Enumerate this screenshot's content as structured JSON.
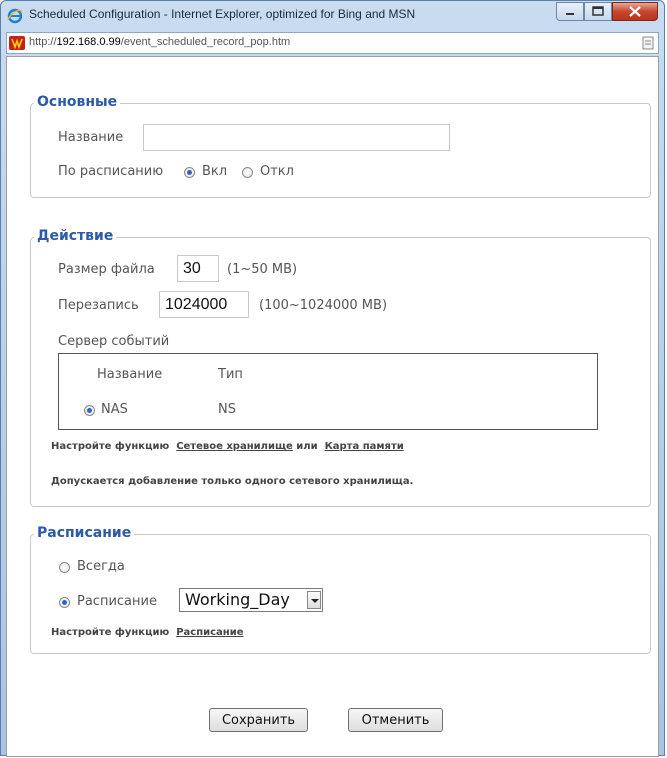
{
  "window": {
    "title": "Scheduled Configuration - Internet Explorer, optimized for Bing and MSN",
    "url_prefix": "http://",
    "url_host": "192.168.0.99",
    "url_path": "/event_scheduled_record_pop.htm"
  },
  "basic": {
    "legend": "Основные",
    "name_label": "Название",
    "name_value": "",
    "schedule_label": "По расписанию",
    "on_label": "Вкл",
    "off_label": "Откл",
    "schedule_state": "on"
  },
  "action": {
    "legend": "Действие",
    "file_size_label": "Размер файла",
    "file_size_value": "30",
    "file_size_range": "(1~50 MB)",
    "overwrite_label": "Перезапись",
    "overwrite_value": "1024000",
    "overwrite_range": "(100~1024000 MB)",
    "event_server_label": "Сервер событий",
    "table_headers": [
      "Название",
      "Тип"
    ],
    "table_rows": [
      {
        "name": "NAS",
        "type": "NS",
        "selected": true
      }
    ],
    "config_prefix": "Настройте функцию",
    "nas_link": "Сетевое хранилище",
    "or_text": "или",
    "sd_link": "Карта памяти",
    "note": "Допускается добавление только одного сетевого хранилища."
  },
  "schedule": {
    "legend": "Расписание",
    "always_label": "Всегда",
    "schedule_label": "Расписание",
    "schedule_value": "Working_Day",
    "selected": "schedule",
    "config_prefix": "Настройте функцию",
    "schedule_link": "Расписание"
  },
  "buttons": {
    "save": "Сохранить",
    "cancel": "Отменить"
  },
  "colors": {
    "legend": "#2c5aa6",
    "radio_dot": "#2f63c9",
    "close_button": "#c9452c"
  }
}
